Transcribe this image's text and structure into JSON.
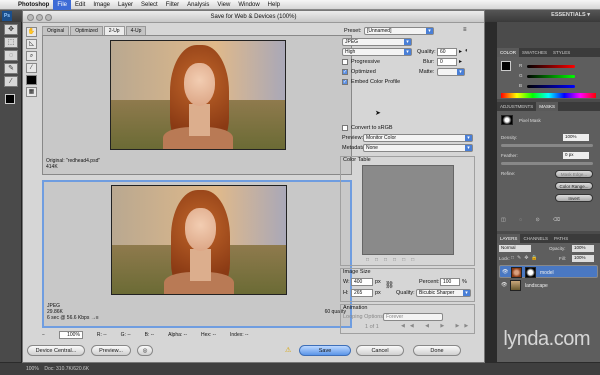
{
  "menubar": {
    "app": "Photoshop",
    "items": [
      "File",
      "Edit",
      "Image",
      "Layer",
      "Select",
      "Filter",
      "Analysis",
      "View",
      "Window",
      "Help"
    ]
  },
  "appbar": {
    "workspace": "ESSENTIALS ▾",
    "logo": "Ps"
  },
  "dialog": {
    "title": "Save for Web & Devices (100%)",
    "tabs": [
      "Original",
      "Optimized",
      "2-Up",
      "4-Up"
    ],
    "original": {
      "name": "Original: \"redhead4.psd\"",
      "size": "414K"
    },
    "optimized": {
      "format": "JPEG",
      "size": "29.86K",
      "time": "6 sec @ 56.6 Kbps",
      "icon": "→≡",
      "quality_note": "60 quality"
    },
    "status": {
      "zoom": "100%",
      "r": "R: --",
      "g": "G: --",
      "b": "B: --",
      "alpha": "Alpha: --",
      "hex": "Hex: --",
      "index": "Index: --"
    },
    "buttons": {
      "device_central": "Device Central...",
      "preview": "Preview...",
      "save": "Save",
      "cancel": "Cancel",
      "done": "Done"
    },
    "settings": {
      "preset_label": "Preset:",
      "preset": "[Unnamed]",
      "format": "JPEG",
      "quality_preset": "High",
      "quality_label": "Quality:",
      "quality": "60",
      "progressive": "Progressive",
      "blur_label": "Blur:",
      "blur": "0",
      "optimized": "Optimized",
      "matte_label": "Matte:",
      "embed_profile": "Embed Color Profile",
      "convert_srgb": "Convert to sRGB",
      "preview_label": "Preview:",
      "preview": "Monitor Color",
      "metadata_label": "Metadata:",
      "metadata": "None",
      "color_table": "Color Table",
      "image_size": "Image Size",
      "w_label": "W:",
      "w": "400",
      "h_label": "H:",
      "h": "265",
      "px": "px",
      "percent_label": "Percent:",
      "percent": "100",
      "pct_unit": "%",
      "quality2_label": "Quality:",
      "resample": "Bicubic Sharper",
      "animation": "Animation",
      "looping_label": "Looping Options:",
      "looping": "Forever",
      "frame": "1 of 1"
    }
  },
  "panels": {
    "color_tabs": [
      "COLOR",
      "SWATCHES",
      "STYLES"
    ],
    "rgb": [
      "R",
      "G",
      "B"
    ],
    "adjust_tabs": [
      "ADJUSTMENTS",
      "MASKS"
    ],
    "pixel_mask": "Pixel Mask",
    "density_label": "Density:",
    "density": "100%",
    "feather_label": "Feather:",
    "feather": "0 px",
    "refine_label": "Refine:",
    "mask_edge": "Mask Edge...",
    "color_range": "Color Range...",
    "invert": "Invert",
    "layer_tabs": [
      "LAYERS",
      "CHANNELS",
      "PATHS"
    ],
    "blend": "Normal",
    "opacity_label": "Opacity:",
    "opacity": "100%",
    "lock_label": "Lock:",
    "fill_label": "Fill:",
    "fill": "100%",
    "layers": [
      "model",
      "landscape"
    ]
  },
  "bottombar": {
    "zoom": "100%",
    "doc": "Doc: 310.7K/620.6K"
  },
  "watermark": "lynda.com",
  "colors": {
    "accent": "#4a7fd6",
    "selected_border": "#6f9de0",
    "save_button": "#5b95e8"
  }
}
